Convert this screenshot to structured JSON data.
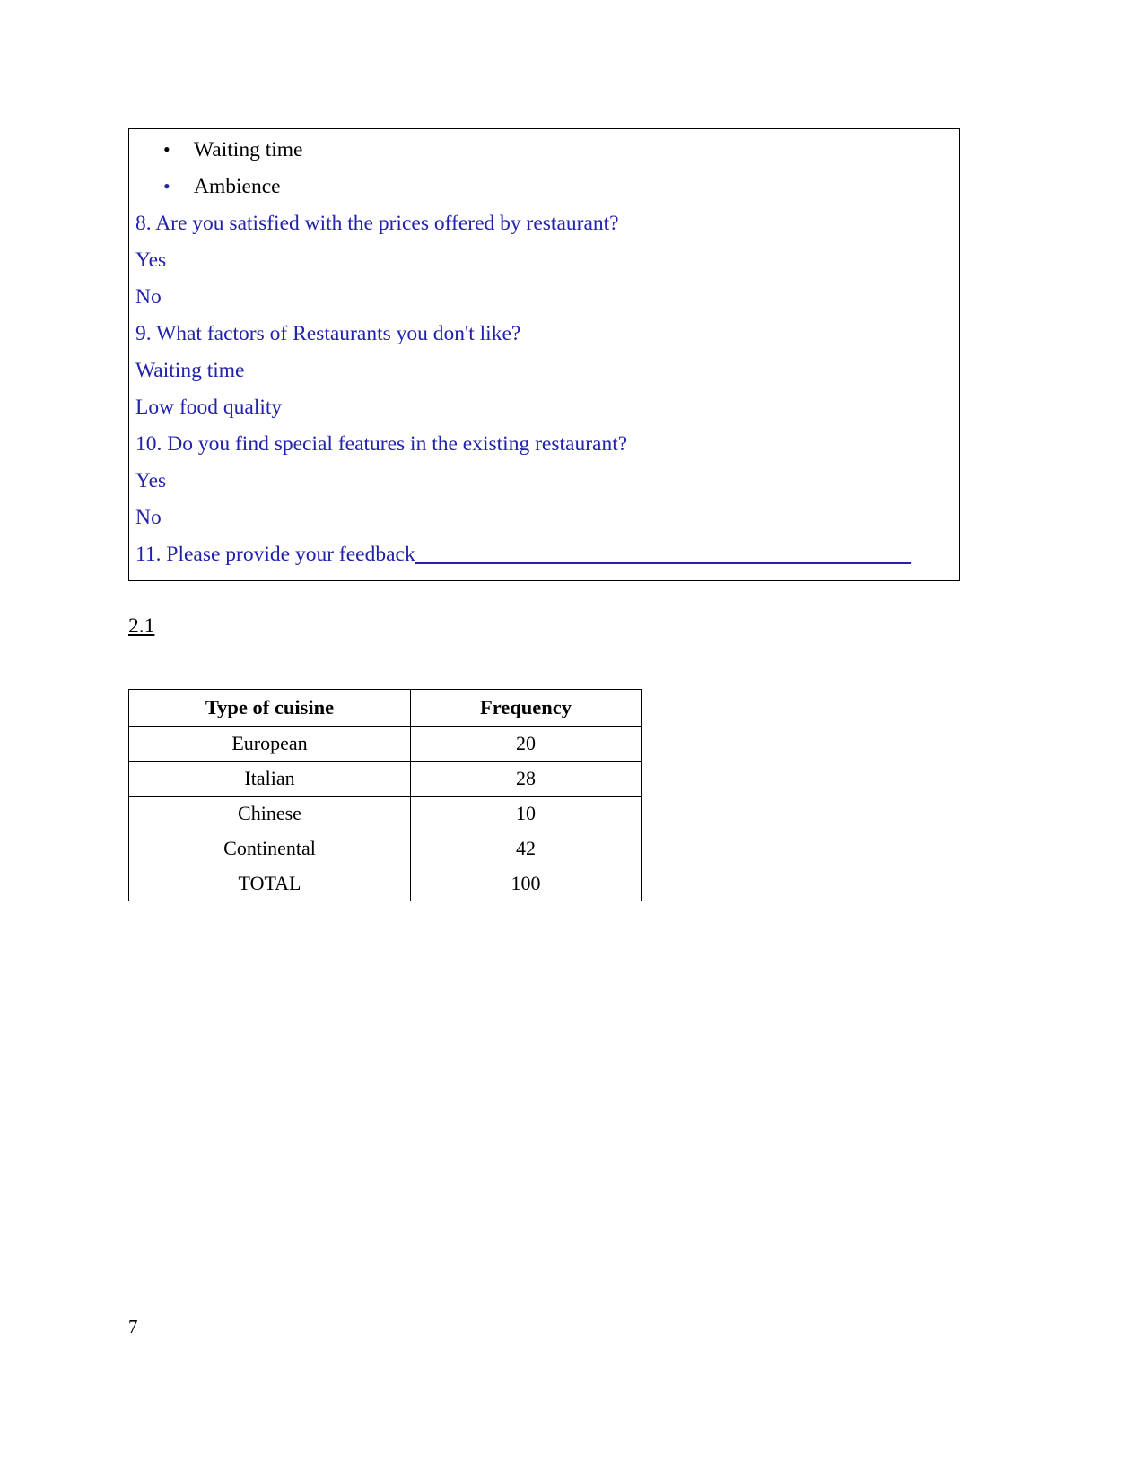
{
  "page": {
    "number": "7",
    "text_color_question": "#2222aa",
    "text_color_body": "#000000"
  },
  "questionnaire_box": {
    "bullets": [
      {
        "label": "Waiting time",
        "bullet_color": "#000000"
      },
      {
        "label": "Ambience",
        "bullet_color": "#2222aa"
      }
    ],
    "lines": [
      {
        "text": "8. Are you satisfied with the prices offered by restaurant?"
      },
      {
        "text": "Yes"
      },
      {
        "text": "No"
      },
      {
        "text": "9. What factors of Restaurants you don't like?"
      },
      {
        "text": "Waiting time"
      },
      {
        "text": "Low food quality"
      },
      {
        "text": "10. Do you find special features in the existing restaurant?"
      },
      {
        "text": "Yes"
      },
      {
        "text": "No"
      }
    ],
    "feedback_line": {
      "label": "11. Please provide your feedback",
      "rule": "_______________________________________________"
    }
  },
  "section": {
    "heading": "2.1"
  },
  "chart_data": {
    "type": "table",
    "title": "2.1",
    "columns": [
      "Type of cuisine",
      "Frequency"
    ],
    "categories": [
      "European",
      "Italian",
      "Chinese",
      "Continental"
    ],
    "values": [
      20,
      28,
      10,
      42
    ],
    "total_label": "TOTAL",
    "total_value": 100,
    "rows": [
      {
        "cuisine": "European",
        "frequency": "20"
      },
      {
        "cuisine": "Italian",
        "frequency": "28"
      },
      {
        "cuisine": "Chinese",
        "frequency": "10"
      },
      {
        "cuisine": "Continental",
        "frequency": "42"
      },
      {
        "cuisine": "TOTAL",
        "frequency": "100"
      }
    ]
  }
}
